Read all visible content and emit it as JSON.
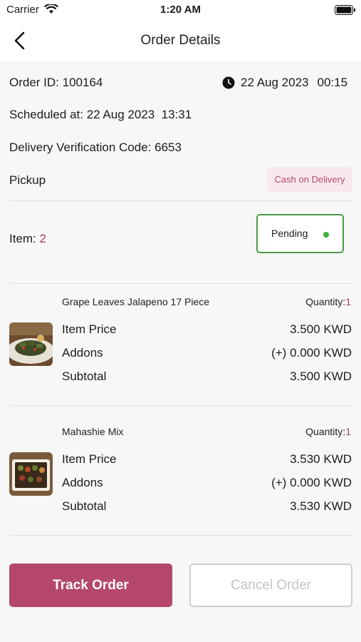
{
  "status_bar": {
    "carrier": "Carrier",
    "time": "1:20 AM"
  },
  "nav": {
    "title": "Order Details"
  },
  "order": {
    "id_label": "Order ID:",
    "id_value": "100164",
    "date": "22 Aug 2023",
    "time": "00:15",
    "scheduled_label": "Scheduled at:",
    "scheduled_value": "22 Aug 2023  13:31",
    "verification_label": "Delivery Verification Code:",
    "verification_value": "6653",
    "delivery_type": "Pickup",
    "payment_method": "Cash on Delivery",
    "items_label": "Item:",
    "items_count": "2",
    "status": "Pending"
  },
  "items": [
    {
      "name": "Grape Leaves Jalapeno 17 Piece",
      "quantity_label": "Quantity:",
      "quantity": "1",
      "price_label": "Item Price",
      "price": "3.500 KWD",
      "addons_label": "Addons",
      "addons": "(+) 0.000 KWD",
      "subtotal_label": "Subtotal",
      "subtotal": "3.500 KWD"
    },
    {
      "name": "Mahashie Mix",
      "quantity_label": "Quantity:",
      "quantity": "1",
      "price_label": "Item Price",
      "price": "3.530 KWD",
      "addons_label": "Addons",
      "addons": "(+) 0.000 KWD",
      "subtotal_label": "Subtotal",
      "subtotal": "3.530 KWD"
    }
  ],
  "actions": {
    "track": "Track Order",
    "cancel": "Cancel Order"
  },
  "colors": {
    "accent": "#b5486a",
    "status_green": "#4a9a47",
    "badge_bg": "#f8e9ee"
  },
  "icons": {
    "back": "chevron-left-icon",
    "clock": "clock-icon",
    "wifi": "wifi-icon",
    "battery": "battery-icon"
  }
}
